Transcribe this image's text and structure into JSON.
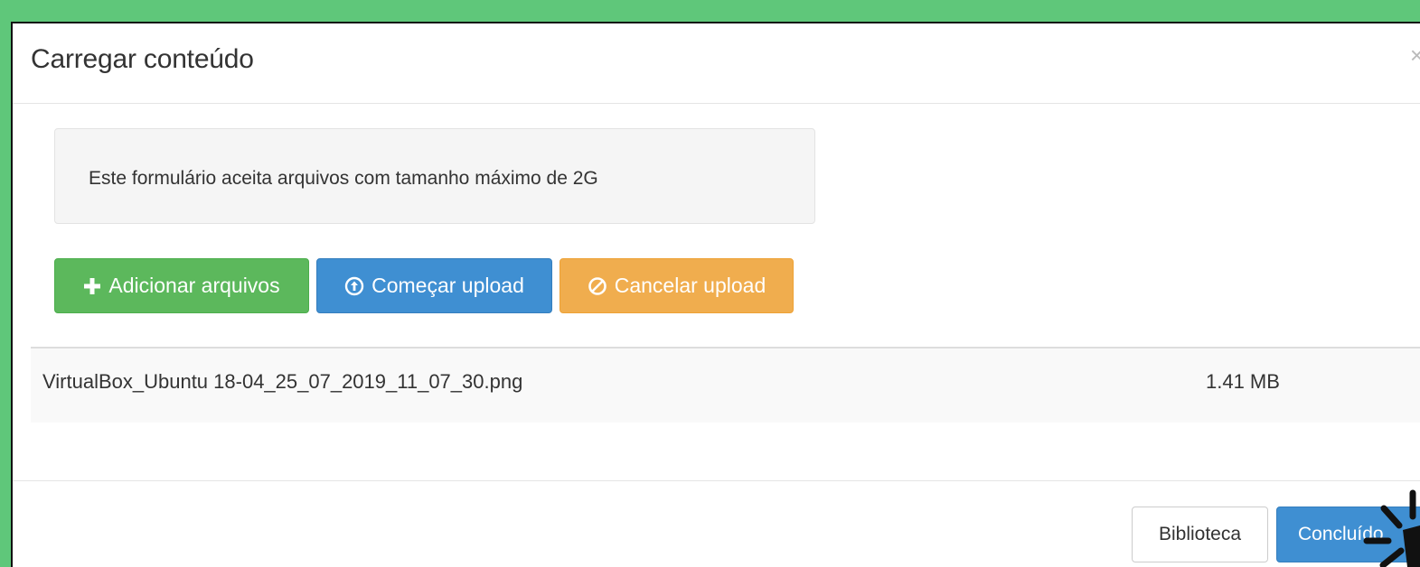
{
  "dialog": {
    "title": "Carregar conteúdo",
    "close_label": "×"
  },
  "notice": {
    "text": "Este formulário aceita arquivos com tamanho máximo de 2G"
  },
  "actions": {
    "add_label": "Adicionar arquivos",
    "start_label": "Começar upload",
    "cancel_label": "Cancelar upload"
  },
  "files": [
    {
      "name": "VirtualBox_Ubuntu 18-04_25_07_2019_11_07_30.png",
      "size": "1.41 MB"
    }
  ],
  "footer": {
    "library_label": "Biblioteca",
    "done_label": "Concluído"
  },
  "colors": {
    "background": "#5fc77a",
    "success": "#5cb85c",
    "primary": "#3f8fd2",
    "warning": "#f0ad4e"
  },
  "icons": {
    "add": "plus-icon",
    "start": "upload-circle-icon",
    "cancel": "ban-icon",
    "close": "close-icon",
    "cursor": "click-burst-icon"
  }
}
